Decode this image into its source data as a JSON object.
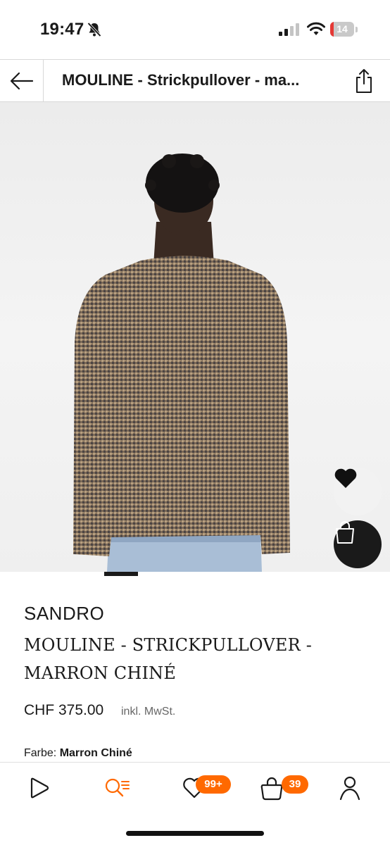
{
  "status_bar": {
    "time": "19:47",
    "battery_level": 14,
    "battery_label": "14",
    "icons": [
      "bell-slash-icon",
      "cellular-signal-icon",
      "wifi-icon",
      "battery-icon"
    ]
  },
  "header": {
    "title": "MOULINE - Strickpullover - ma...",
    "back_icon": "arrow-left-icon",
    "share_icon": "share-icon"
  },
  "gallery": {
    "image_alt": "Model back view wearing knitted sweater",
    "active_slide": 1,
    "wishlist_icon": "heart-icon",
    "bag_icon": "shopping-bag-icon"
  },
  "product": {
    "brand": "SANDRO",
    "name_line1": "MOULINE - STRICKPULLOVER -",
    "name_line2": "MARRON CHINÉ",
    "price": "CHF 375.00",
    "tax_note": "inkl. MwSt.",
    "color_label": "Farbe:",
    "color_value": "Marron Chiné"
  },
  "bottom_nav": {
    "items": [
      {
        "name": "home",
        "icon": "play-outline-icon"
      },
      {
        "name": "search",
        "icon": "search-list-icon",
        "active": true
      },
      {
        "name": "wishlist",
        "icon": "heart-outline-icon",
        "badge": "99+"
      },
      {
        "name": "bag",
        "icon": "bag-outline-icon",
        "badge": "39"
      },
      {
        "name": "account",
        "icon": "person-icon"
      }
    ]
  },
  "colors": {
    "accent": "#ff6900",
    "text": "#1a1a1a",
    "battery_low": "#e53935",
    "image_bg": "#efefef"
  }
}
